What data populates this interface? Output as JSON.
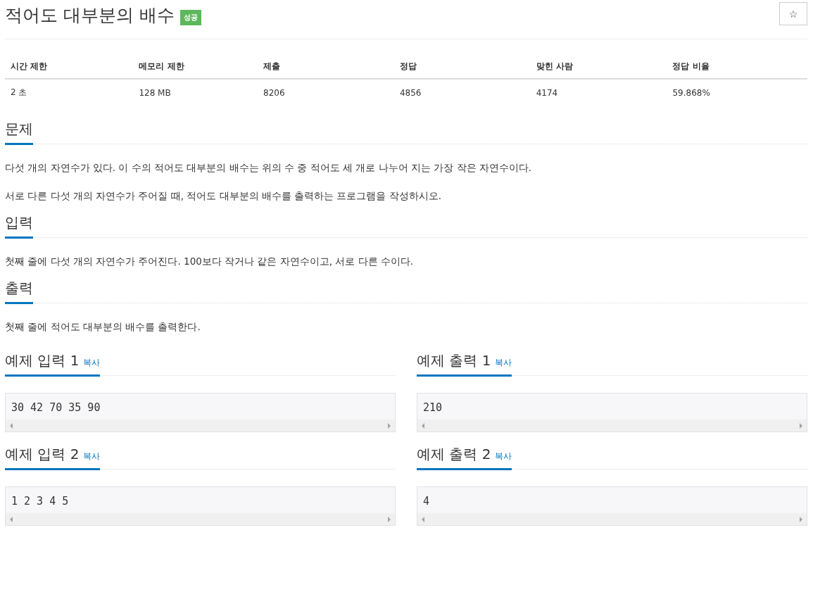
{
  "title": "적어도 대부분의 배수",
  "badge": "성공",
  "star_button": "☆",
  "info_table": {
    "columns": [
      "시간 제한",
      "메모리 제한",
      "제출",
      "정답",
      "맞힌 사람",
      "정답 비율"
    ],
    "rows": [
      [
        "2 초",
        "128 MB",
        "8206",
        "4856",
        "4174",
        "59.868%"
      ]
    ]
  },
  "sections": [
    {
      "heading": "문제",
      "paragraphs": [
        "다섯 개의 자연수가 있다. 이 수의 적어도 대부분의 배수는 위의 수 중 적어도 세 개로 나누어 지는 가장 작은 자연수이다.",
        "서로 다른 다섯 개의 자연수가 주어질 때, 적어도 대부분의 배수를 출력하는 프로그램을 작성하시오."
      ]
    },
    {
      "heading": "입력",
      "paragraphs": [
        "첫째 줄에 다섯 개의 자연수가 주어진다. 100보다 작거나 같은 자연수이고, 서로 다른 수이다."
      ]
    },
    {
      "heading": "출력",
      "paragraphs": [
        "첫째 줄에 적어도 대부분의 배수를 출력한다."
      ]
    }
  ],
  "samples": [
    {
      "heading": "예제 입력 1",
      "copy_link": "복사",
      "content": "30 42 70 35 90"
    },
    {
      "heading": "예제 출력 1",
      "copy_link": "복사",
      "content": "210"
    },
    {
      "heading": "예제 입력 2",
      "copy_link": "복사",
      "content": "1 2 3 4 5"
    },
    {
      "heading": "예제 출력 2",
      "copy_link": "복사",
      "content": "4"
    }
  ]
}
